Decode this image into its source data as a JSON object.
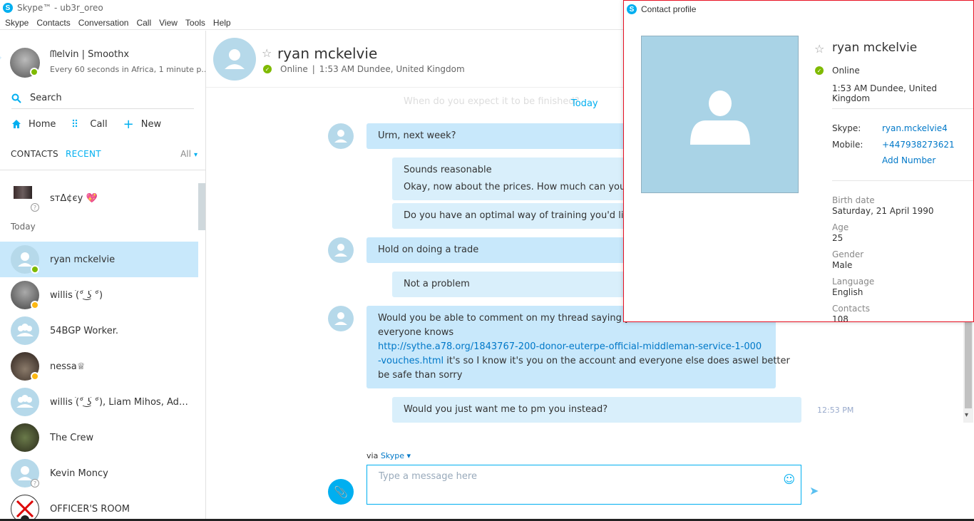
{
  "window": {
    "title": "Skype™ - ub3r_oreo"
  },
  "menu": [
    "Skype",
    "Contacts",
    "Conversation",
    "Call",
    "View",
    "Tools",
    "Help"
  ],
  "me": {
    "name": "ᗰelvin | Smoothx",
    "mood": "Every 60 seconds in Africa, 1 minute p..."
  },
  "search": {
    "label": "Search"
  },
  "nav": {
    "home": "Home",
    "call": "Call",
    "new": "New"
  },
  "tabs": {
    "contacts": "CONTACTS",
    "recent": "RECENT",
    "all": "All"
  },
  "recent": {
    "pinned": {
      "name": "sтΔ¢єy 💖"
    },
    "today_label": "Today",
    "items": [
      {
        "name": "ryan mckelvie",
        "status": "online"
      },
      {
        "name": "willis (͡° ͜ʖ ͡°)",
        "status": "away"
      },
      {
        "name": "54BGP Worker.",
        "status": "group"
      },
      {
        "name": "nessa♕",
        "status": "away"
      },
      {
        "name": "willis (͡° ͜ʖ ͡°), Liam Mihos, Adam...",
        "status": "group"
      },
      {
        "name": "The Crew",
        "status": "none"
      },
      {
        "name": "Kevin Moncy",
        "status": "unknown"
      },
      {
        "name": "OFFICER'S ROOM",
        "status": "none"
      }
    ]
  },
  "conversation": {
    "name": "ryan mckelvie",
    "status": "Online",
    "location": "1:53 AM Dundee, United Kingdom",
    "faded_message": "When do you expect it to be finished?",
    "today_marker": "Today",
    "messages": [
      {
        "text": "Urm, next week?"
      },
      {
        "text": "Sounds reasonable"
      },
      {
        "text": "Okay, now about the prices. How much can you offer"
      },
      {
        "text": "Do you have an optimal way of training you'd like me"
      },
      {
        "text": "Hold on doing a trade"
      },
      {
        "text": "Not a problem"
      },
      {
        "text_1": "Would you be able to comment on my thread saying you w",
        "text_2": "everyone knows",
        "link_1": "http://sythe.a78.org/1843767-200-donor-euterpe-official-middleman-service-1-000",
        "link_2": "-vouches.html",
        "text_3": " it's so I know it's you on the account and everyone else does aswel better",
        "text_4": "be safe than sorry"
      },
      {
        "text": "Would you just want me to pm you instead?",
        "time": "12:53 PM"
      }
    ],
    "via_label": "via",
    "via_service": "Skype",
    "input_placeholder": "Type a message here"
  },
  "contact_profile": {
    "window_title": "Contact profile",
    "name": "ryan mckelvie",
    "status": "Online",
    "local_time": "1:53 AM Dundee, United Kingdom",
    "skype_label": "Skype:",
    "skype_value": "ryan.mckelvie4",
    "mobile_label": "Mobile:",
    "mobile_value": "+447938273621",
    "add_number": "Add Number",
    "birth_label": "Birth date",
    "birth_value": "Saturday, 21 April 1990",
    "age_label": "Age",
    "age_value": "25",
    "gender_label": "Gender",
    "gender_value": "Male",
    "language_label": "Language",
    "language_value": "English",
    "contacts_label": "Contacts",
    "contacts_value": "108"
  },
  "colors": {
    "accent": "#00aff0",
    "selected": "#c8e8fb",
    "online": "#7fba00",
    "away": "#fdb813",
    "close_border": "#e81123"
  },
  "icons": [
    "skype-icon",
    "search-icon",
    "home-icon",
    "dialpad-icon",
    "plus-icon",
    "chevron-down-icon",
    "star-icon",
    "check-icon",
    "paperclip-icon",
    "emoji-icon",
    "send-icon",
    "person-icon",
    "group-icon"
  ]
}
